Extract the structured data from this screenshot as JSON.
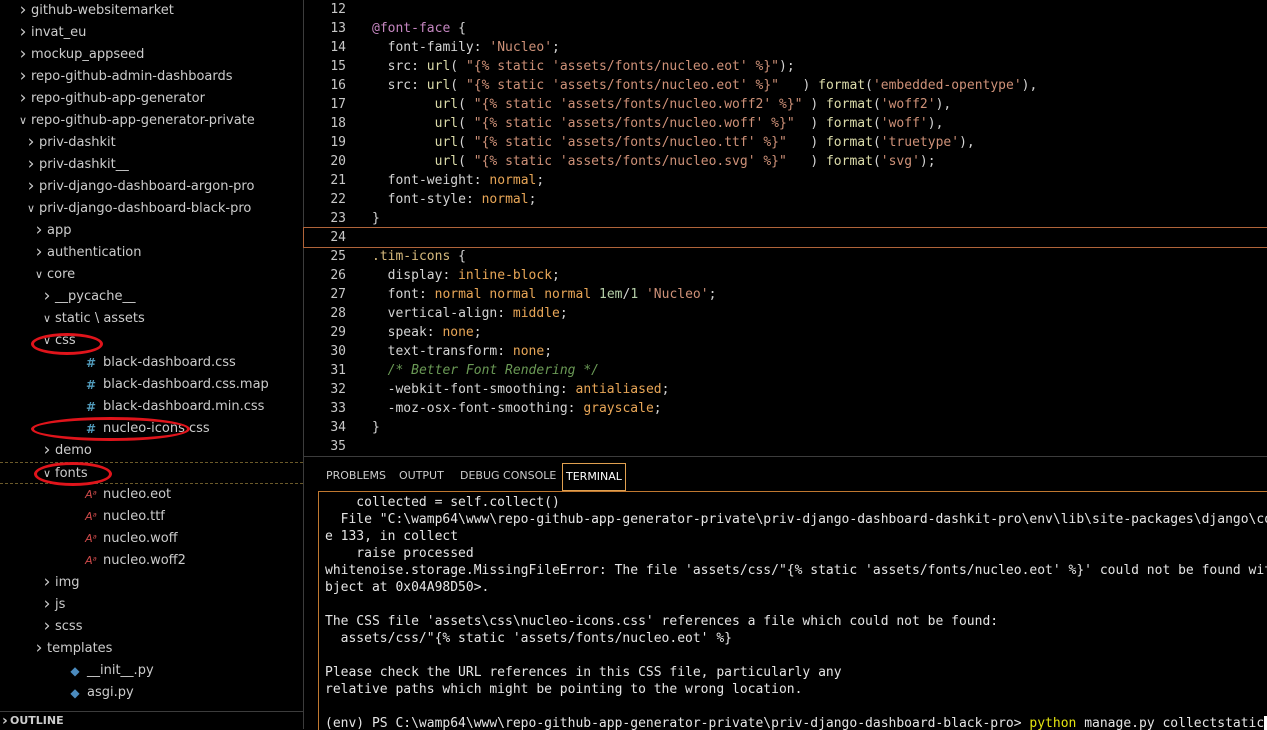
{
  "explorer": {
    "items": [
      {
        "label": "github-websitemarket",
        "kind": "folder-closed"
      },
      {
        "label": "invat_eu",
        "kind": "folder-closed"
      },
      {
        "label": "mockup_appseed",
        "kind": "folder-closed"
      },
      {
        "label": "repo-github-admin-dashboards",
        "kind": "folder-closed"
      },
      {
        "label": "repo-github-app-generator",
        "kind": "folder-closed"
      },
      {
        "label": "repo-github-app-generator-private",
        "kind": "folder-open"
      },
      {
        "label": "priv-dashkit",
        "kind": "folder-closed"
      },
      {
        "label": "priv-dashkit__",
        "kind": "folder-closed"
      },
      {
        "label": "priv-django-dashboard-argon-pro",
        "kind": "folder-closed"
      },
      {
        "label": "priv-django-dashboard-black-pro",
        "kind": "folder-open"
      },
      {
        "label": "app",
        "kind": "folder-closed"
      },
      {
        "label": "authentication",
        "kind": "folder-closed"
      },
      {
        "label": "core",
        "kind": "folder-open"
      },
      {
        "label": "__pycache__",
        "kind": "folder-closed"
      },
      {
        "label": "static \\ assets",
        "kind": "folder-open"
      },
      {
        "label": "css",
        "kind": "folder-open"
      },
      {
        "label": "black-dashboard.css",
        "kind": "css-file"
      },
      {
        "label": "black-dashboard.css.map",
        "kind": "css-file"
      },
      {
        "label": "black-dashboard.min.css",
        "kind": "css-file"
      },
      {
        "label": "nucleo-icons.css",
        "kind": "css-file"
      },
      {
        "label": "demo",
        "kind": "folder-closed"
      },
      {
        "label": "fonts",
        "kind": "folder-open"
      },
      {
        "label": "nucleo.eot",
        "kind": "font-file"
      },
      {
        "label": "nucleo.ttf",
        "kind": "font-file"
      },
      {
        "label": "nucleo.woff",
        "kind": "font-file"
      },
      {
        "label": "nucleo.woff2",
        "kind": "font-file"
      },
      {
        "label": "img",
        "kind": "folder-closed"
      },
      {
        "label": "js",
        "kind": "folder-closed"
      },
      {
        "label": "scss",
        "kind": "folder-closed"
      },
      {
        "label": "templates",
        "kind": "folder-closed"
      },
      {
        "label": "__init__.py",
        "kind": "py-file"
      },
      {
        "label": "asgi.py",
        "kind": "py-file"
      }
    ],
    "outline_label": "OUTLINE",
    "css_glyph": "#",
    "font_glyph": "Aᵃ",
    "py_glyph": "◆"
  },
  "editor": {
    "lines": [
      {
        "n": "12",
        "html": ""
      },
      {
        "n": "13",
        "html": "<span class='at'>@font-face</span> {"
      },
      {
        "n": "14",
        "html": "  <span class='prop'>font-family</span>: <span class='val'>'Nucleo'</span>;"
      },
      {
        "n": "15",
        "html": "  <span class='prop'>src</span>: <span class='fn'>url</span>( <span class='val'>\"{% static 'assets/fonts/nucleo.eot' %}\"</span>);"
      },
      {
        "n": "16",
        "html": "  <span class='prop'>src</span>: <span class='fn'>url</span>( <span class='val'>\"{% static 'assets/fonts/nucleo.eot' %}\"</span>   ) <span class='fn'>format</span>(<span class='val'>'embedded-opentype'</span>),"
      },
      {
        "n": "17",
        "html": "        <span class='fn'>url</span>( <span class='val'>\"{% static 'assets/fonts/nucleo.woff2' %}\"</span> ) <span class='fn'>format</span>(<span class='val'>'woff2'</span>),"
      },
      {
        "n": "18",
        "html": "        <span class='fn'>url</span>( <span class='val'>\"{% static 'assets/fonts/nucleo.woff' %}\"</span>  ) <span class='fn'>format</span>(<span class='val'>'woff'</span>),"
      },
      {
        "n": "19",
        "html": "        <span class='fn'>url</span>( <span class='val'>\"{% static 'assets/fonts/nucleo.ttf' %}\"</span>   ) <span class='fn'>format</span>(<span class='val'>'truetype'</span>),"
      },
      {
        "n": "20",
        "html": "        <span class='fn'>url</span>( <span class='val'>\"{% static 'assets/fonts/nucleo.svg' %}\"</span>   ) <span class='fn'>format</span>(<span class='val'>'svg'</span>);"
      },
      {
        "n": "21",
        "html": "  <span class='prop'>font-weight</span>: <span class='kw'>normal</span>;"
      },
      {
        "n": "22",
        "html": "  <span class='prop'>font-style</span>: <span class='kw'>normal</span>;"
      },
      {
        "n": "23",
        "html": "}"
      },
      {
        "n": "24",
        "html": ""
      },
      {
        "n": "25",
        "html": "<span class='sel'>.tim-icons</span> {"
      },
      {
        "n": "26",
        "html": "  <span class='prop'>display</span>: <span class='kw'>inline-block</span>;"
      },
      {
        "n": "27",
        "html": "  <span class='prop'>font</span>: <span class='kw'>normal normal normal</span> <span class='num'>1em</span>/<span class='num'>1</span> <span class='val'>'Nucleo'</span>;"
      },
      {
        "n": "28",
        "html": "  <span class='prop'>vertical-align</span>: <span class='kw'>middle</span>;"
      },
      {
        "n": "29",
        "html": "  <span class='prop'>speak</span>: <span class='kw'>none</span>;"
      },
      {
        "n": "30",
        "html": "  <span class='prop'>text-transform</span>: <span class='kw'>none</span>;"
      },
      {
        "n": "31",
        "html": "  <span class='cmt'>/* Better Font Rendering */</span>"
      },
      {
        "n": "32",
        "html": "  <span class='prop'>-webkit-font-smoothing</span>: <span class='kw'>antialiased</span>;"
      },
      {
        "n": "33",
        "html": "  <span class='prop'>-moz-osx-font-smoothing</span>: <span class='kw'>grayscale</span>;"
      },
      {
        "n": "34",
        "html": "}"
      },
      {
        "n": "35",
        "html": ""
      }
    ]
  },
  "panel": {
    "tabs": [
      "PROBLEMS",
      "OUTPUT",
      "DEBUG CONSOLE",
      "TERMINAL"
    ],
    "active_tab": "TERMINAL",
    "terminal_lines": [
      "    collected = self.collect()",
      "  File \"C:\\wamp64\\www\\repo-github-app-generator-private\\priv-django-dashboard-dashkit-pro\\env\\lib\\site-packages\\django\\cont",
      "e 133, in collect",
      "    raise processed",
      "whitenoise.storage.MissingFileError: The file 'assets/css/\"{% static 'assets/fonts/nucleo.eot' %}' could not be found with",
      "bject at 0x04A98D50>.",
      "",
      "The CSS file 'assets\\css\\nucleo-icons.css' references a file which could not be found:",
      "  assets/css/\"{% static 'assets/fonts/nucleo.eot' %}",
      "",
      "Please check the URL references in this CSS file, particularly any",
      "relative paths which might be pointing to the wrong location.",
      ""
    ],
    "prompt": "(env) PS C:\\wamp64\\www\\repo-github-app-generator-private\\priv-django-dashboard-black-pro> ",
    "cmd_exe": "python",
    "cmd_args": " manage.py collectstatic"
  }
}
